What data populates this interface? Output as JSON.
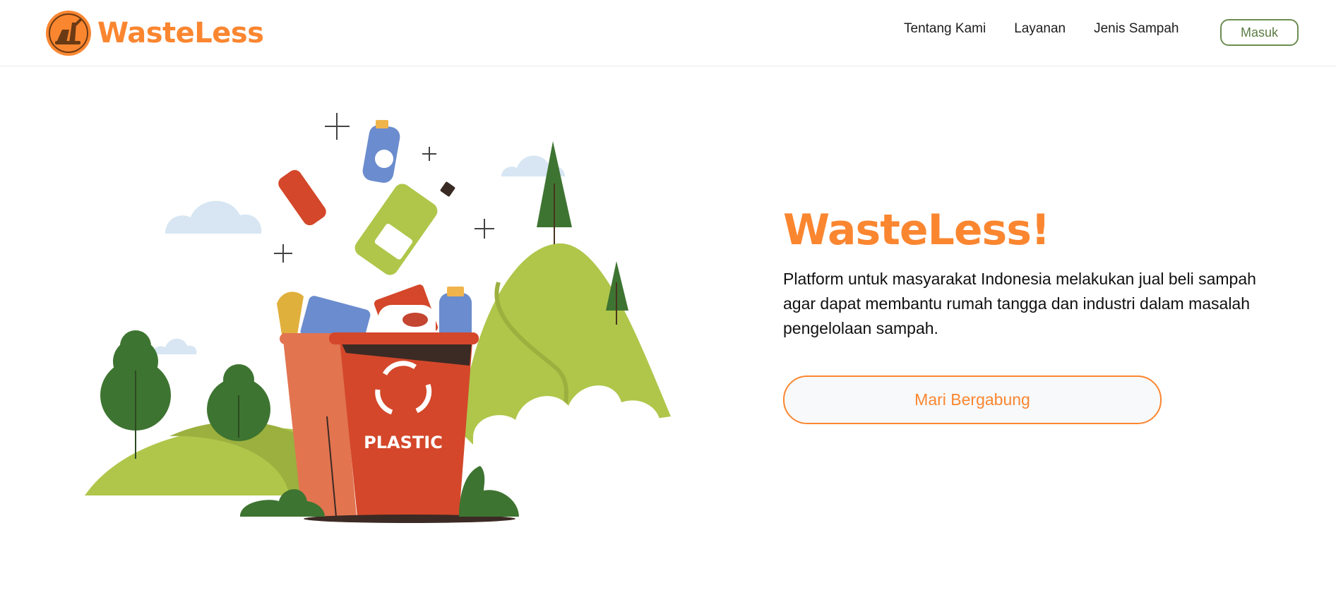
{
  "brand": {
    "name": "WasteLess",
    "logo_icon": "broom-logo-icon",
    "color": "#fb8630"
  },
  "nav": {
    "links": [
      "Tentang Kami",
      "Layanan",
      "Jenis Sampah"
    ],
    "login_label": "Masuk"
  },
  "hero": {
    "title": "WasteLess!",
    "description": "Platform untuk masyarakat Indonesia melakukan jual beli sampah agar dapat membantu rumah tangga dan industri dalam masalah pengelolaan sampah.",
    "cta_label": "Mari Bergabung",
    "illustration": {
      "bin_label": "PLASTIC",
      "icon": "recycle-bin-illustration"
    }
  },
  "colors": {
    "accent": "#fb8630",
    "login_border": "#6b8e52",
    "bin_red": "#d4472a",
    "hill_green": "#afc64a",
    "tree_green": "#3e7431"
  }
}
